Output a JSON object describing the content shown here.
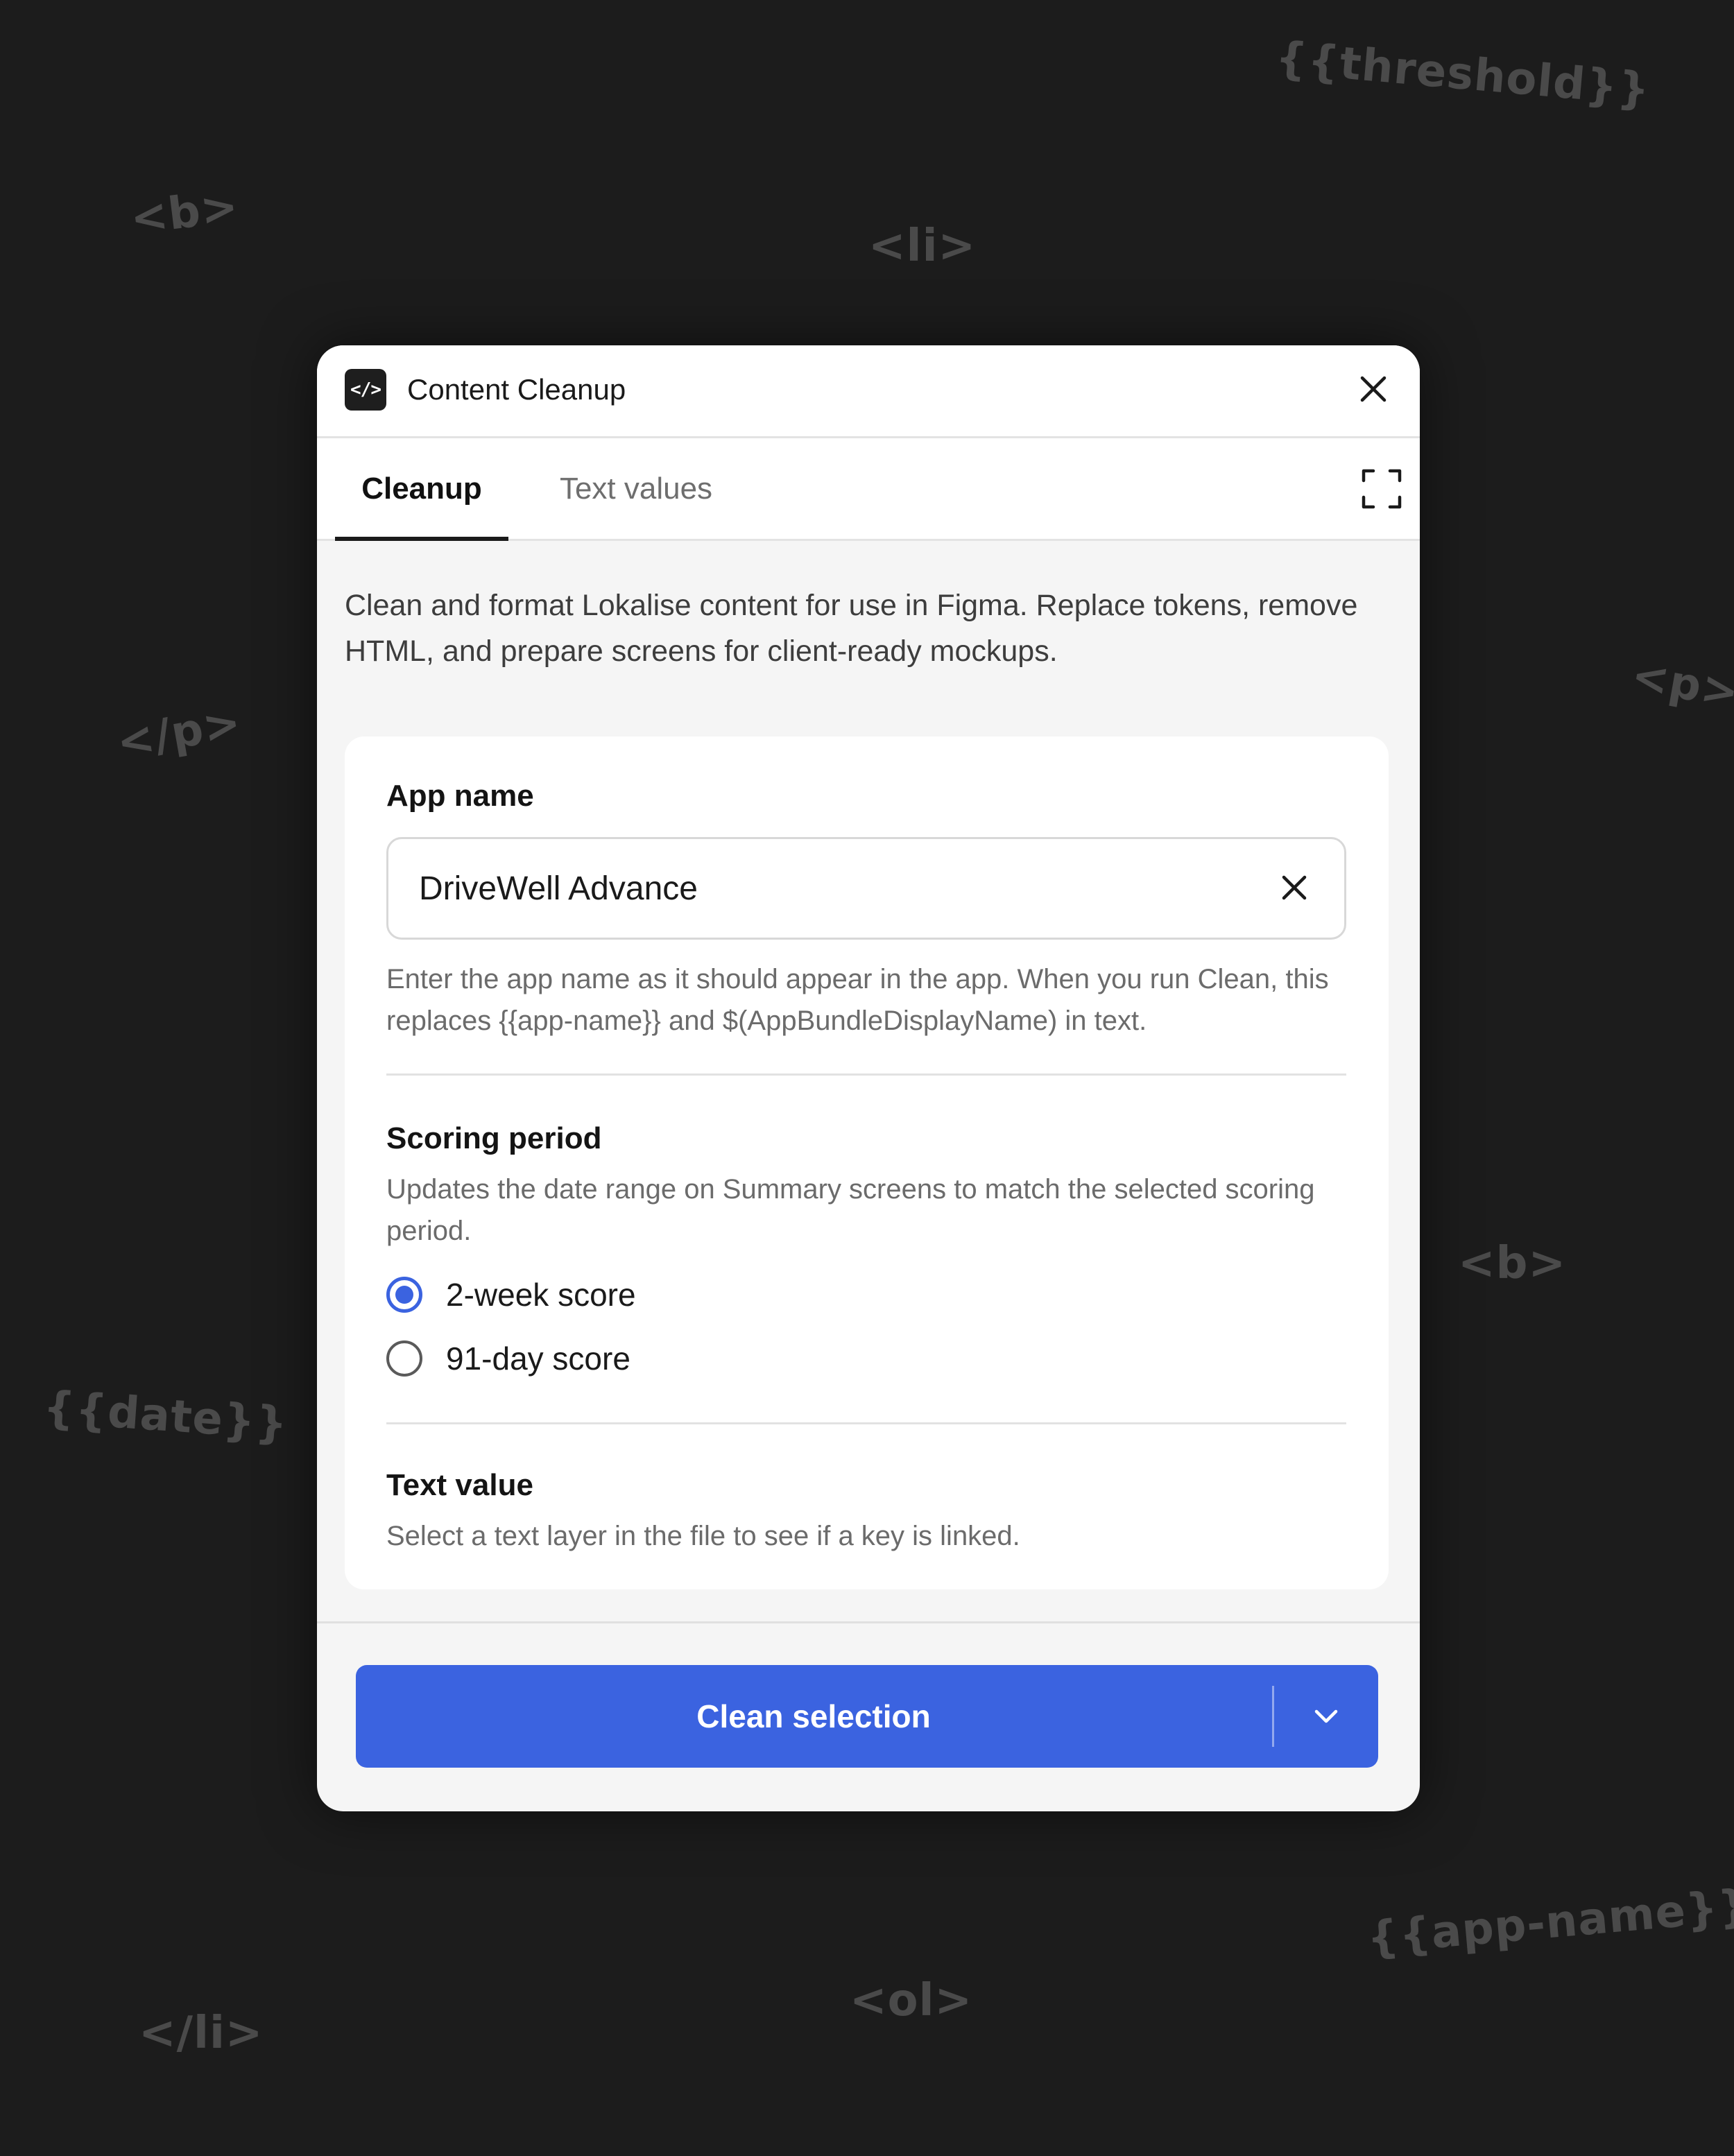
{
  "background_tags": [
    "{{threshold}}",
    "<b>",
    "<li>",
    "<p>",
    "</p>",
    "<b>",
    "{{date}}",
    "{{app-name}}",
    "</li>",
    "<ol>"
  ],
  "window": {
    "icon_glyph": "</>",
    "title": "Content Cleanup"
  },
  "tabs": {
    "active": "Cleanup",
    "inactive": "Text values"
  },
  "intro": "Clean and format Lokalise content for use in Figma. Replace tokens, remove HTML, and prepare screens for client-ready mockups.",
  "app_name": {
    "heading": "App name",
    "value": "DriveWell Advance",
    "help": "Enter the app name as it should appear in the app. When you run Clean, this replaces {{app-name}} and $(AppBundleDisplayName) in text."
  },
  "scoring": {
    "heading": "Scoring period",
    "help": "Updates the date range on Summary screens to match the selected scoring period.",
    "options": [
      {
        "label": "2-week score",
        "selected": true
      },
      {
        "label": "91-day score",
        "selected": false
      }
    ]
  },
  "text_value": {
    "heading": "Text value",
    "help": "Select a text layer in the file to see if a key is linked."
  },
  "action": {
    "label": "Clean selection"
  },
  "colors": {
    "accent": "#3b63e0",
    "background": "#1c1c1c",
    "panel": "#f5f5f5"
  },
  "icons": [
    "code-icon",
    "close-icon",
    "expand-icon",
    "clear-icon",
    "chevron-down-icon"
  ]
}
